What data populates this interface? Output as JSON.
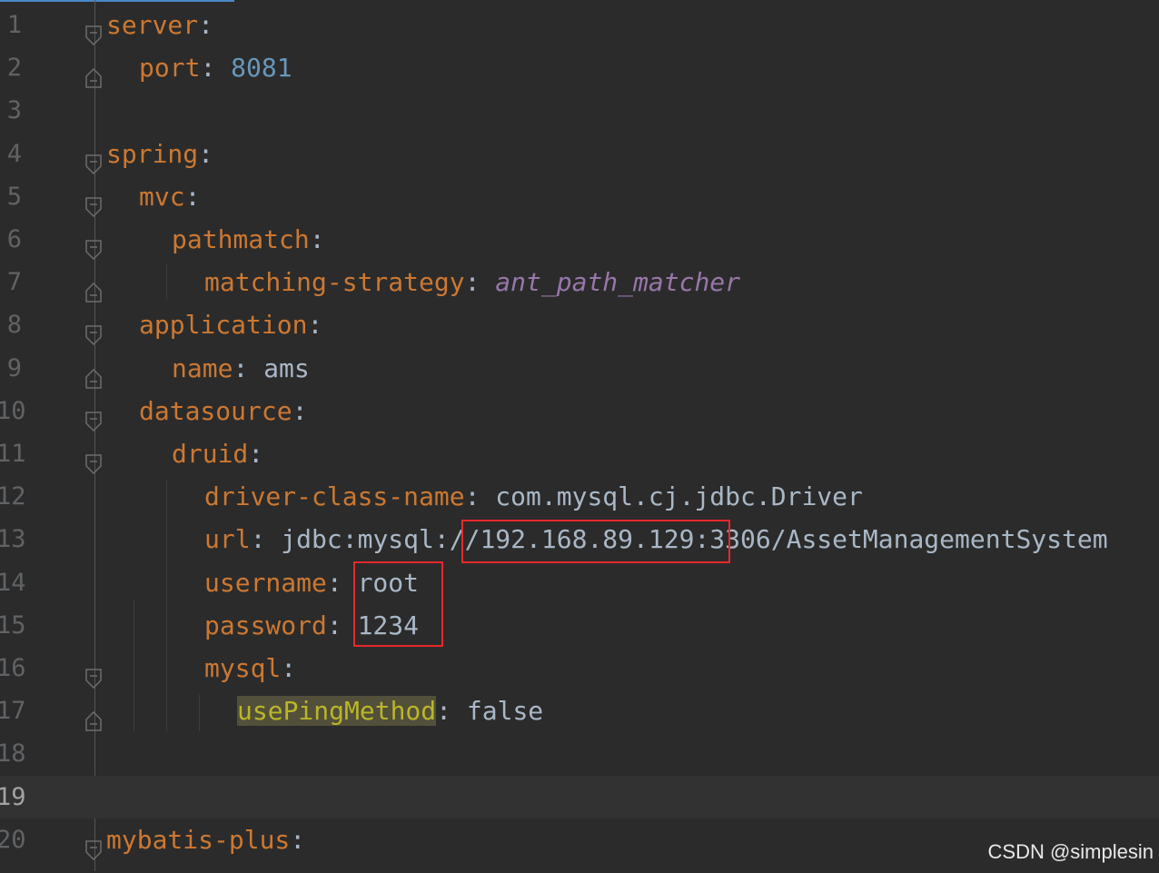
{
  "editor": {
    "lines": [
      {
        "num": "1",
        "key": "server",
        "sep": ":",
        "value": "",
        "fold": "open"
      },
      {
        "num": "2",
        "key": "port",
        "sep": ": ",
        "value": "8081",
        "valueType": "number",
        "fold": "close"
      },
      {
        "num": "3",
        "key": "",
        "sep": "",
        "value": ""
      },
      {
        "num": "4",
        "key": "spring",
        "sep": ":",
        "value": "",
        "fold": "open"
      },
      {
        "num": "5",
        "key": "mvc",
        "sep": ":",
        "value": "",
        "fold": "open"
      },
      {
        "num": "6",
        "key": "pathmatch",
        "sep": ":",
        "value": "",
        "fold": "open"
      },
      {
        "num": "7",
        "key": "matching-strategy",
        "sep": ": ",
        "value": "ant_path_matcher",
        "valueType": "constant",
        "fold": "close"
      },
      {
        "num": "8",
        "key": "application",
        "sep": ":",
        "value": "",
        "fold": "open"
      },
      {
        "num": "9",
        "key": "name",
        "sep": ": ",
        "value": "ams",
        "fold": "close"
      },
      {
        "num": "10",
        "key": "datasource",
        "sep": ":",
        "value": "",
        "fold": "open"
      },
      {
        "num": "11",
        "key": "druid",
        "sep": ":",
        "value": "",
        "fold": "open"
      },
      {
        "num": "12",
        "key": "driver-class-name",
        "sep": ": ",
        "value": "com.mysql.cj.jdbc.Driver"
      },
      {
        "num": "13",
        "key": "url",
        "sep": ": ",
        "value": "jdbc:mysql://192.168.89.129:3306/AssetManagementSystem"
      },
      {
        "num": "14",
        "key": "username",
        "sep": ": ",
        "value": "root"
      },
      {
        "num": "15",
        "key": "password",
        "sep": ": ",
        "value": "1234"
      },
      {
        "num": "16",
        "key": "mysql",
        "sep": ":",
        "value": "",
        "fold": "open"
      },
      {
        "num": "17",
        "key": "usePingMethod",
        "sep": ": ",
        "value": "false",
        "highlight": true,
        "fold": "close"
      },
      {
        "num": "18",
        "key": "",
        "sep": "",
        "value": ""
      },
      {
        "num": "19",
        "key": "",
        "sep": "",
        "value": "",
        "current": true
      },
      {
        "num": "20",
        "key": "mybatis-plus",
        "sep": ":",
        "value": "",
        "fold": "open"
      }
    ]
  },
  "watermark": "CSDN @simplesin",
  "colors": {
    "background": "#2b2b2b",
    "key": "#cc7832",
    "text": "#a9b7c6",
    "number": "#6897bb",
    "constant": "#9876aa",
    "highlight": "#52503a",
    "annotation_box": "#e8282c"
  }
}
